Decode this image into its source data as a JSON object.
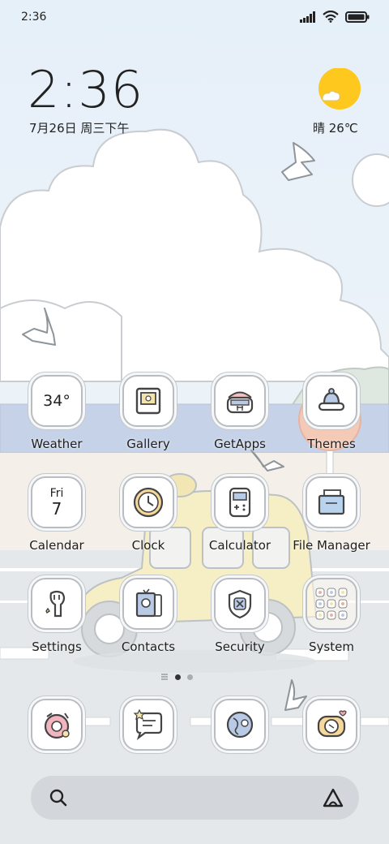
{
  "status_bar": {
    "time": "2:36",
    "icons": [
      "signal-icon",
      "wifi-icon",
      "battery-icon"
    ]
  },
  "clock_widget": {
    "time": "2:36",
    "date": "7月26日 周三下午",
    "weather": "晴 26℃",
    "weather_icon": "sunny-icon"
  },
  "apps": [
    {
      "label": "Weather",
      "icon": "weather-icon",
      "text": "34°"
    },
    {
      "label": "Gallery",
      "icon": "gallery-icon"
    },
    {
      "label": "GetApps",
      "icon": "getapps-icon"
    },
    {
      "label": "Themes",
      "icon": "themes-icon"
    },
    {
      "label": "Calendar",
      "icon": "calendar-icon",
      "day_name": "Fri",
      "day_num": "7"
    },
    {
      "label": "Clock",
      "icon": "clock-icon"
    },
    {
      "label": "Calculator",
      "icon": "calculator-icon"
    },
    {
      "label": "File Manager",
      "icon": "file-manager-icon"
    },
    {
      "label": "Settings",
      "icon": "settings-icon"
    },
    {
      "label": "Contacts",
      "icon": "contacts-icon"
    },
    {
      "label": "Security",
      "icon": "security-icon"
    },
    {
      "label": "System",
      "icon": "system-folder-icon"
    }
  ],
  "page_indicator": {
    "pages": 2,
    "current": 1
  },
  "dock": [
    {
      "icon": "phone-icon"
    },
    {
      "icon": "messages-icon"
    },
    {
      "icon": "browser-icon"
    },
    {
      "icon": "camera-icon"
    }
  ],
  "search_bar": {
    "icon": "search-icon",
    "assistant_icon": "assistant-icon"
  },
  "colors": {
    "sky": "#eaf2f8",
    "sea": "#c3cfe6",
    "sun": "#ffc81e",
    "car": "#f7efc4",
    "text": "#1e1e1e"
  }
}
